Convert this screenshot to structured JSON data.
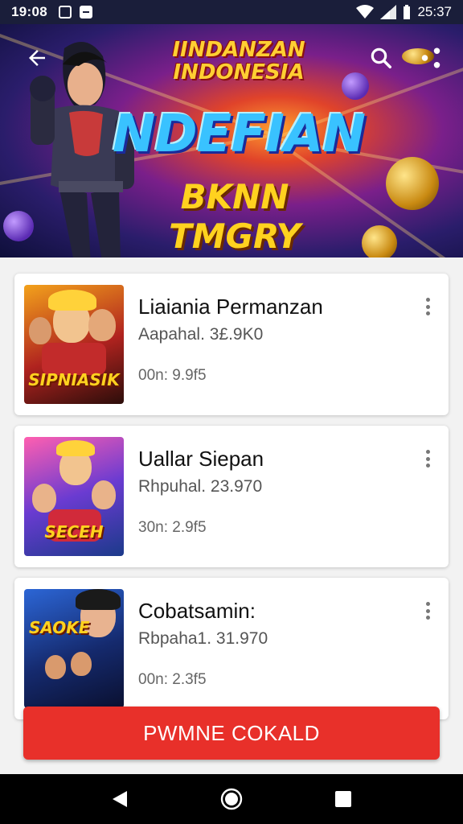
{
  "status_bar": {
    "time": "19:08",
    "battery_text": "25:37"
  },
  "hero": {
    "title_top": "IINDANZAN INDONESIA",
    "title_main": "NDEFIAN",
    "title_sub": "BKNN TMGRY"
  },
  "items": [
    {
      "title": "Liaiania Permanzan",
      "subtitle": "Aapahal. 3£.9K0",
      "meta": "00n: 9.9f5",
      "thumb_label": "SIPNIASIK",
      "thumb_colors": [
        "#f3a21b",
        "#b0231f",
        "#2b0d0a"
      ]
    },
    {
      "title": "Uallar Siepan",
      "subtitle": "Rhpuhal. 23.970",
      "meta": "30n: 2.9f5",
      "thumb_label": "SECEH",
      "thumb_colors": [
        "#ff5fb0",
        "#6a3bd1",
        "#1b3a8a"
      ]
    },
    {
      "title": "Cobatsamin:",
      "subtitle": "Rbpaha1. 31.970",
      "meta": "00n: 2.3f5",
      "thumb_label": "SAOKE",
      "thumb_colors": [
        "#2c66d6",
        "#152a6e",
        "#0a1030"
      ]
    }
  ],
  "cta": {
    "label": "PWMNE COKALD"
  },
  "colors": {
    "accent": "#e8302a",
    "status_bar": "#1a1e3a"
  },
  "icons": {
    "back": "back-arrow-icon",
    "search": "search-icon",
    "share": "share-icon",
    "more": "more-vert-icon",
    "nav_back": "nav-back-icon",
    "nav_home": "nav-home-icon",
    "nav_recents": "nav-recents-icon"
  }
}
